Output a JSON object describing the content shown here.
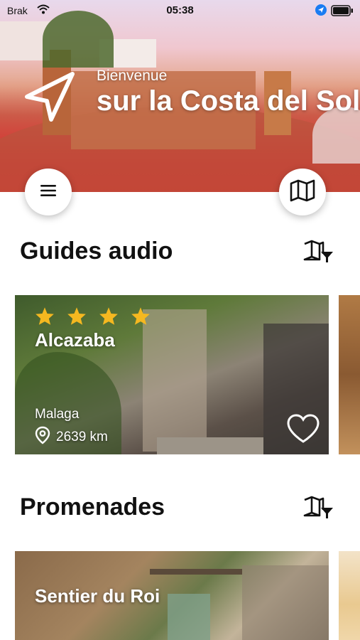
{
  "status_bar": {
    "carrier": "Brak",
    "time": "05:38"
  },
  "hero": {
    "welcome": "Bienvenue",
    "title": "sur la Costa del Sol"
  },
  "sections": [
    {
      "title": "Guides audio",
      "cards": [
        {
          "name": "Alcazaba",
          "rating": 4,
          "city": "Malaga",
          "distance": "2639 km"
        }
      ]
    },
    {
      "title": "Promenades",
      "cards": [
        {
          "name": "Sentier du Roi"
        }
      ]
    }
  ],
  "colors": {
    "hero_accent": "#d63a35",
    "star": "#f5b820",
    "text_dark": "#111111",
    "surface": "#ffffff"
  },
  "icons": {
    "hero": "navigation-arrow-icon",
    "menu": "hamburger-menu-icon",
    "map": "map-icon",
    "filter": "map-filter-icon",
    "star": "star-icon",
    "location": "location-pin-icon",
    "favorite": "heart-icon"
  }
}
